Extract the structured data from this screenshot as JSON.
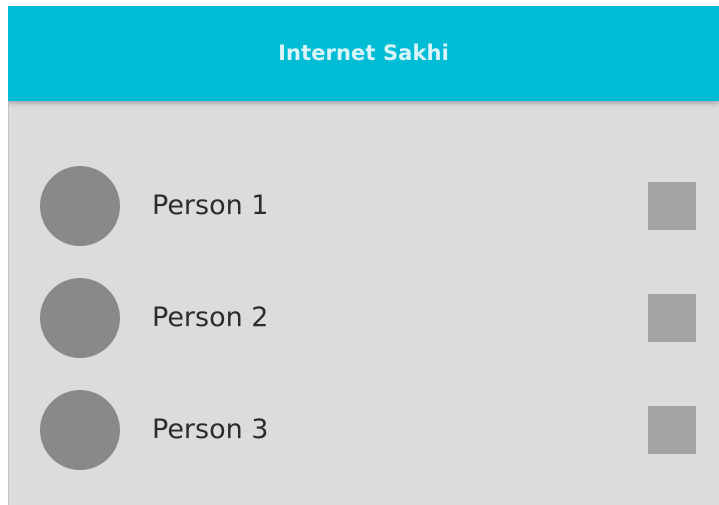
{
  "app_bar": {
    "title": "Internet Sakhi"
  },
  "people": [
    {
      "name": "Person 1"
    },
    {
      "name": "Person 2"
    },
    {
      "name": "Person 3"
    }
  ],
  "colors": {
    "app_bar": "#00bcd4",
    "app_title": "#d9f5fa",
    "background": "#dcdcdc",
    "avatar": "#898989",
    "action_box": "#a3a3a3",
    "text": "#2c2c2c"
  }
}
